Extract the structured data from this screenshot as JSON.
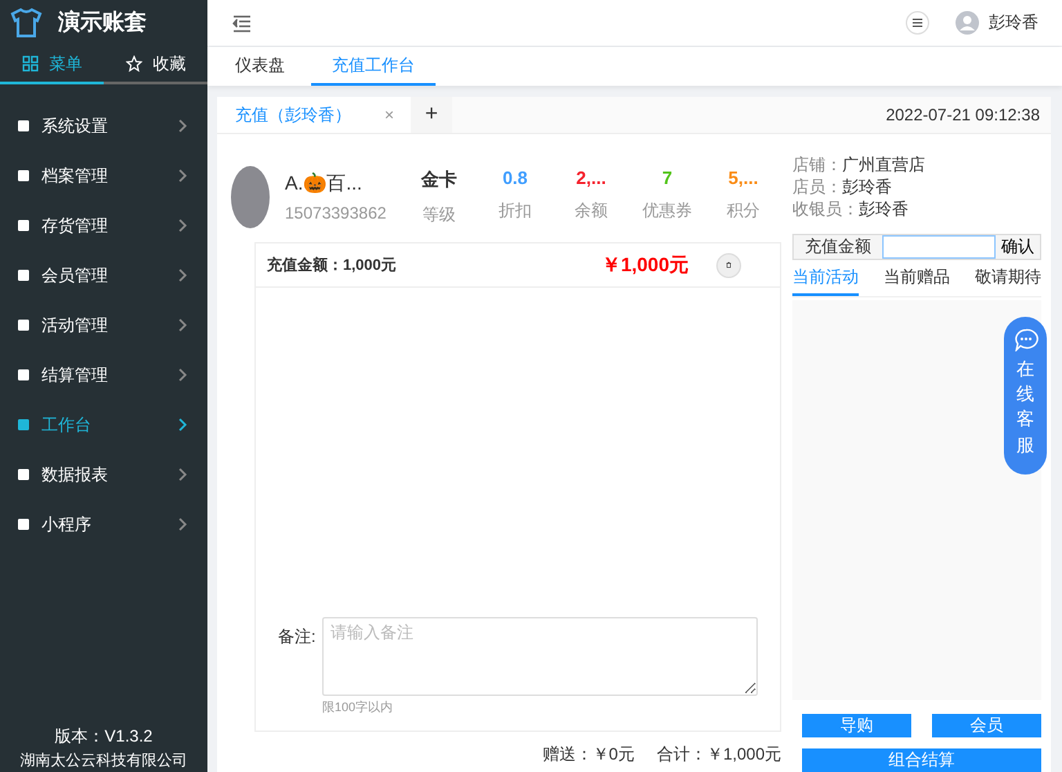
{
  "sidebar": {
    "title": "演示账套",
    "tabs": [
      {
        "label": "菜单",
        "selected": true
      },
      {
        "label": "收藏",
        "selected": false
      }
    ],
    "items": [
      {
        "label": "系统设置",
        "selected": false
      },
      {
        "label": "档案管理",
        "selected": false
      },
      {
        "label": "存货管理",
        "selected": false
      },
      {
        "label": "会员管理",
        "selected": false
      },
      {
        "label": "活动管理",
        "selected": false
      },
      {
        "label": "结算管理",
        "selected": false
      },
      {
        "label": "工作台",
        "selected": true
      },
      {
        "label": "数据报表",
        "selected": false
      },
      {
        "label": "小程序",
        "selected": false
      }
    ],
    "version": "版本：V1.3.2",
    "company": "湖南太公云科技有限公司"
  },
  "header": {
    "user": "彭玲香"
  },
  "nav_tabs": [
    {
      "label": "仪表盘",
      "selected": false
    },
    {
      "label": "充值工作台",
      "selected": true
    }
  ],
  "page_tabs": [
    {
      "label": "充值（彭玲香）",
      "selected": true,
      "close": "×"
    }
  ],
  "add_tab": "+",
  "datetime": "2022-07-21 09:12:38",
  "member": {
    "name": "A.🎃百...",
    "phone": "15073393862",
    "stats": [
      {
        "value": "金卡",
        "label": "等级",
        "color": "#333333"
      },
      {
        "value": "0.8",
        "label": "折扣",
        "color": "#409eff"
      },
      {
        "value": "2,...",
        "label": "余额",
        "color": "#f5222d"
      },
      {
        "value": "7",
        "label": "优惠券",
        "color": "#52c41a"
      },
      {
        "value": "5,...",
        "label": "积分",
        "color": "#fa8c16"
      }
    ]
  },
  "recharge": {
    "item": "充值金额：1,000元",
    "price": "￥1,000元",
    "remark_label": "备注:",
    "remark_placeholder": "请输入备注",
    "remark_hint": "限100字以内"
  },
  "totals": [
    {
      "label": "赠送：",
      "value": "￥0元"
    },
    {
      "label": "合计：",
      "value": "￥1,000元"
    }
  ],
  "info": [
    {
      "label": "店铺：",
      "value": "广州直营店"
    },
    {
      "label": "店员：",
      "value": "彭玲香"
    },
    {
      "label": "收银员：",
      "value": "彭玲香"
    }
  ],
  "amount_input": {
    "label": "充值金额",
    "button": "确认"
  },
  "side_tabs": [
    {
      "label": "当前活动",
      "selected": true
    },
    {
      "label": "当前赠品",
      "selected": false
    },
    {
      "label": "敬请期待",
      "selected": false
    }
  ],
  "buttons": [
    "导购",
    "会员",
    "组合结算"
  ],
  "service": "在线客服"
}
